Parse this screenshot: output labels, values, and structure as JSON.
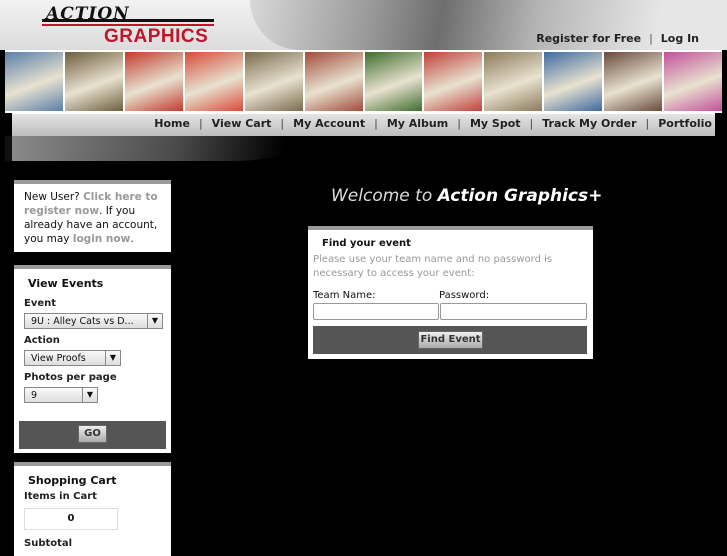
{
  "brand": {
    "line1": "ACTION",
    "line2": "GRAPHICS +"
  },
  "top_links": [
    "Register for Free",
    "Log In"
  ],
  "photos": [
    "#5a7fa8",
    "#6e5d3c",
    "#c23a2e",
    "#d84a3a",
    "#7a6a4e",
    "#a34b3a",
    "#3f6d2c",
    "#c1403a",
    "#8c7a5a",
    "#3e6aa0",
    "#6a4a3a",
    "#c44f9a"
  ],
  "nav": [
    "Home",
    "View Cart",
    "My Account",
    "My Album",
    "My Spot",
    "Track My Order",
    "Portfolio"
  ],
  "new_user": {
    "prefix": "New User?",
    "link1": "Click here to register now",
    "middle": ". If you already have an account, you may",
    "link2": "login now",
    "suffix": "."
  },
  "view_events": {
    "title": "View Events",
    "event_label": "Event",
    "event_value": "9U : Alley Cats vs D...",
    "action_label": "Action",
    "action_value": "View Proofs",
    "ppp_label": "Photos per page",
    "ppp_value": "9",
    "go_label": "GO"
  },
  "cart": {
    "title": "Shopping Cart",
    "items_label": "Items in Cart",
    "items_value": "0",
    "subtotal_label": "Subtotal"
  },
  "welcome": {
    "prefix": "Welcome to",
    "brand": "Action Graphics+"
  },
  "find": {
    "title": "Find your event",
    "hint": "Please use your team name and no password is necessary to access your event:",
    "team_label": "Team Name:",
    "password_label": "Password:",
    "team_value": "",
    "password_value": "",
    "button": "Find Event"
  }
}
